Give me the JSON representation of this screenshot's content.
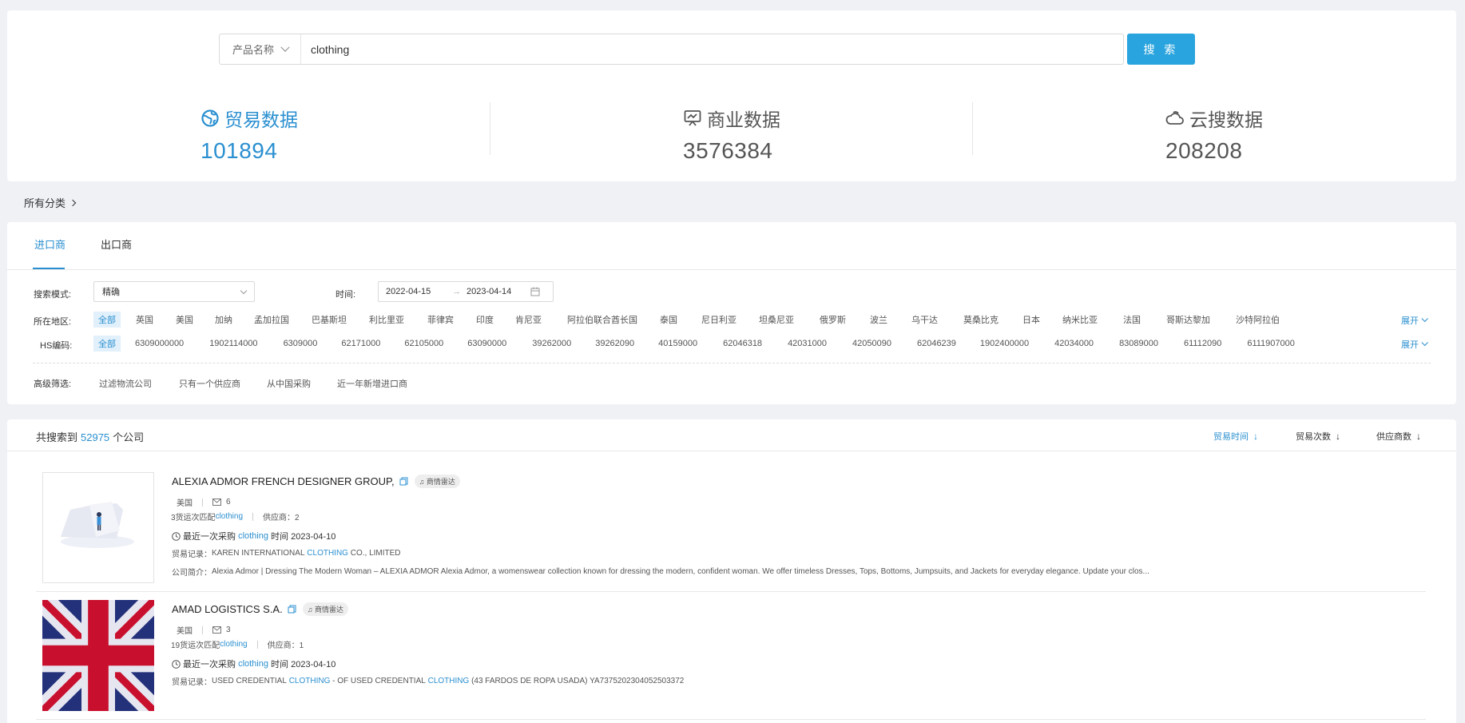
{
  "search": {
    "type_label": "产品名称",
    "value": "clothing",
    "button_label": "搜 索"
  },
  "stats": [
    {
      "label": "贸易数据",
      "value": "101894",
      "icon": "globe-icon"
    },
    {
      "label": "商业数据",
      "value": "3576384",
      "icon": "presentation-icon"
    },
    {
      "label": "云搜数据",
      "value": "208208",
      "icon": "cloud-icon"
    }
  ],
  "breadcrumb": "所有分类",
  "tabs": [
    "进口商",
    "出口商"
  ],
  "filters": {
    "mode_label": "搜索模式:",
    "mode_value": "精确",
    "time_label": "时间:",
    "date_start": "2022-04-15",
    "date_end": "2023-04-14",
    "region_label": "所在地区:",
    "regions": [
      "全部",
      "英国",
      "美国",
      "加纳",
      "孟加拉国",
      "巴基斯坦",
      "利比里亚",
      "菲律宾",
      "印度",
      "肯尼亚",
      "阿拉伯联合酋长国",
      "泰国",
      "尼日利亚",
      "坦桑尼亚",
      "俄罗斯",
      "波兰",
      "乌干达",
      "莫桑比克",
      "日本",
      "纳米比亚",
      "法国",
      "哥斯达黎加",
      "沙特阿拉伯"
    ],
    "hs_label": "HS编码:",
    "hs_codes": [
      "全部",
      "6309000000",
      "1902114000",
      "6309000",
      "62171000",
      "62105000",
      "63090000",
      "39262000",
      "39262090",
      "40159000",
      "62046318",
      "42031000",
      "42050090",
      "62046239",
      "1902400000",
      "42034000",
      "83089000",
      "61112090",
      "6111907000"
    ],
    "expand_label": "展开",
    "adv_label": "高级筛选:",
    "adv_options": [
      "过滤物流公司",
      "只有一个供应商",
      "从中国采购",
      "近一年新增进口商"
    ]
  },
  "results": {
    "prefix": "共搜索到",
    "count": "52975",
    "suffix": "个公司",
    "sorts": [
      "贸易时间",
      "贸易次数",
      "供应商数"
    ]
  },
  "companies": [
    {
      "name": "ALEXIA ADMOR FRENCH DESIGNER GROUP,",
      "tag": "商情雷达",
      "country": "美国",
      "mail_count": "6",
      "match_prefix": "3货运次匹配",
      "match_kw": "clothing",
      "supplier": "供应商：2",
      "recent_prefix": "最近一次采购",
      "recent_kw": "clothing",
      "recent_time": "时间 2023-04-10",
      "trade_label": "贸易记录：",
      "trade_a": "KAREN INTERNATIONAL",
      "trade_kw": "CLOTHING",
      "trade_b": "CO., LIMITED",
      "intro_label": "公司简介：",
      "intro": "Alexia Admor | Dressing The Modern Woman – ALEXIA ADMOR Alexia Admor, a womenswear collection known for dressing the modern, confident woman. We offer timeless Dresses, Tops, Bottoms, Jumpsuits, and Jackets for everyday elegance. Update your clos..."
    },
    {
      "name": "AMAD LOGISTICS S.A.",
      "tag": "商情雷达",
      "country": "美国",
      "mail_count": "3",
      "match_prefix": "19货运次匹配",
      "match_kw": "clothing",
      "supplier": "供应商：1",
      "recent_prefix": "最近一次采购",
      "recent_kw": "clothing",
      "recent_time": "时间 2023-04-10",
      "trade_label": "贸易记录：",
      "trade_a": "USED CREDENTIAL",
      "trade_kw": "CLOTHING",
      "trade_b": "- OF USED CREDENTIAL",
      "trade_kw2": "CLOTHING",
      "trade_c": "(43 FARDOS DE ROPA USADA) YA7375202304052503372"
    }
  ],
  "colors": {
    "accent": "#2a8fd0",
    "button": "#2aa4de",
    "background": "#eff1f5"
  }
}
